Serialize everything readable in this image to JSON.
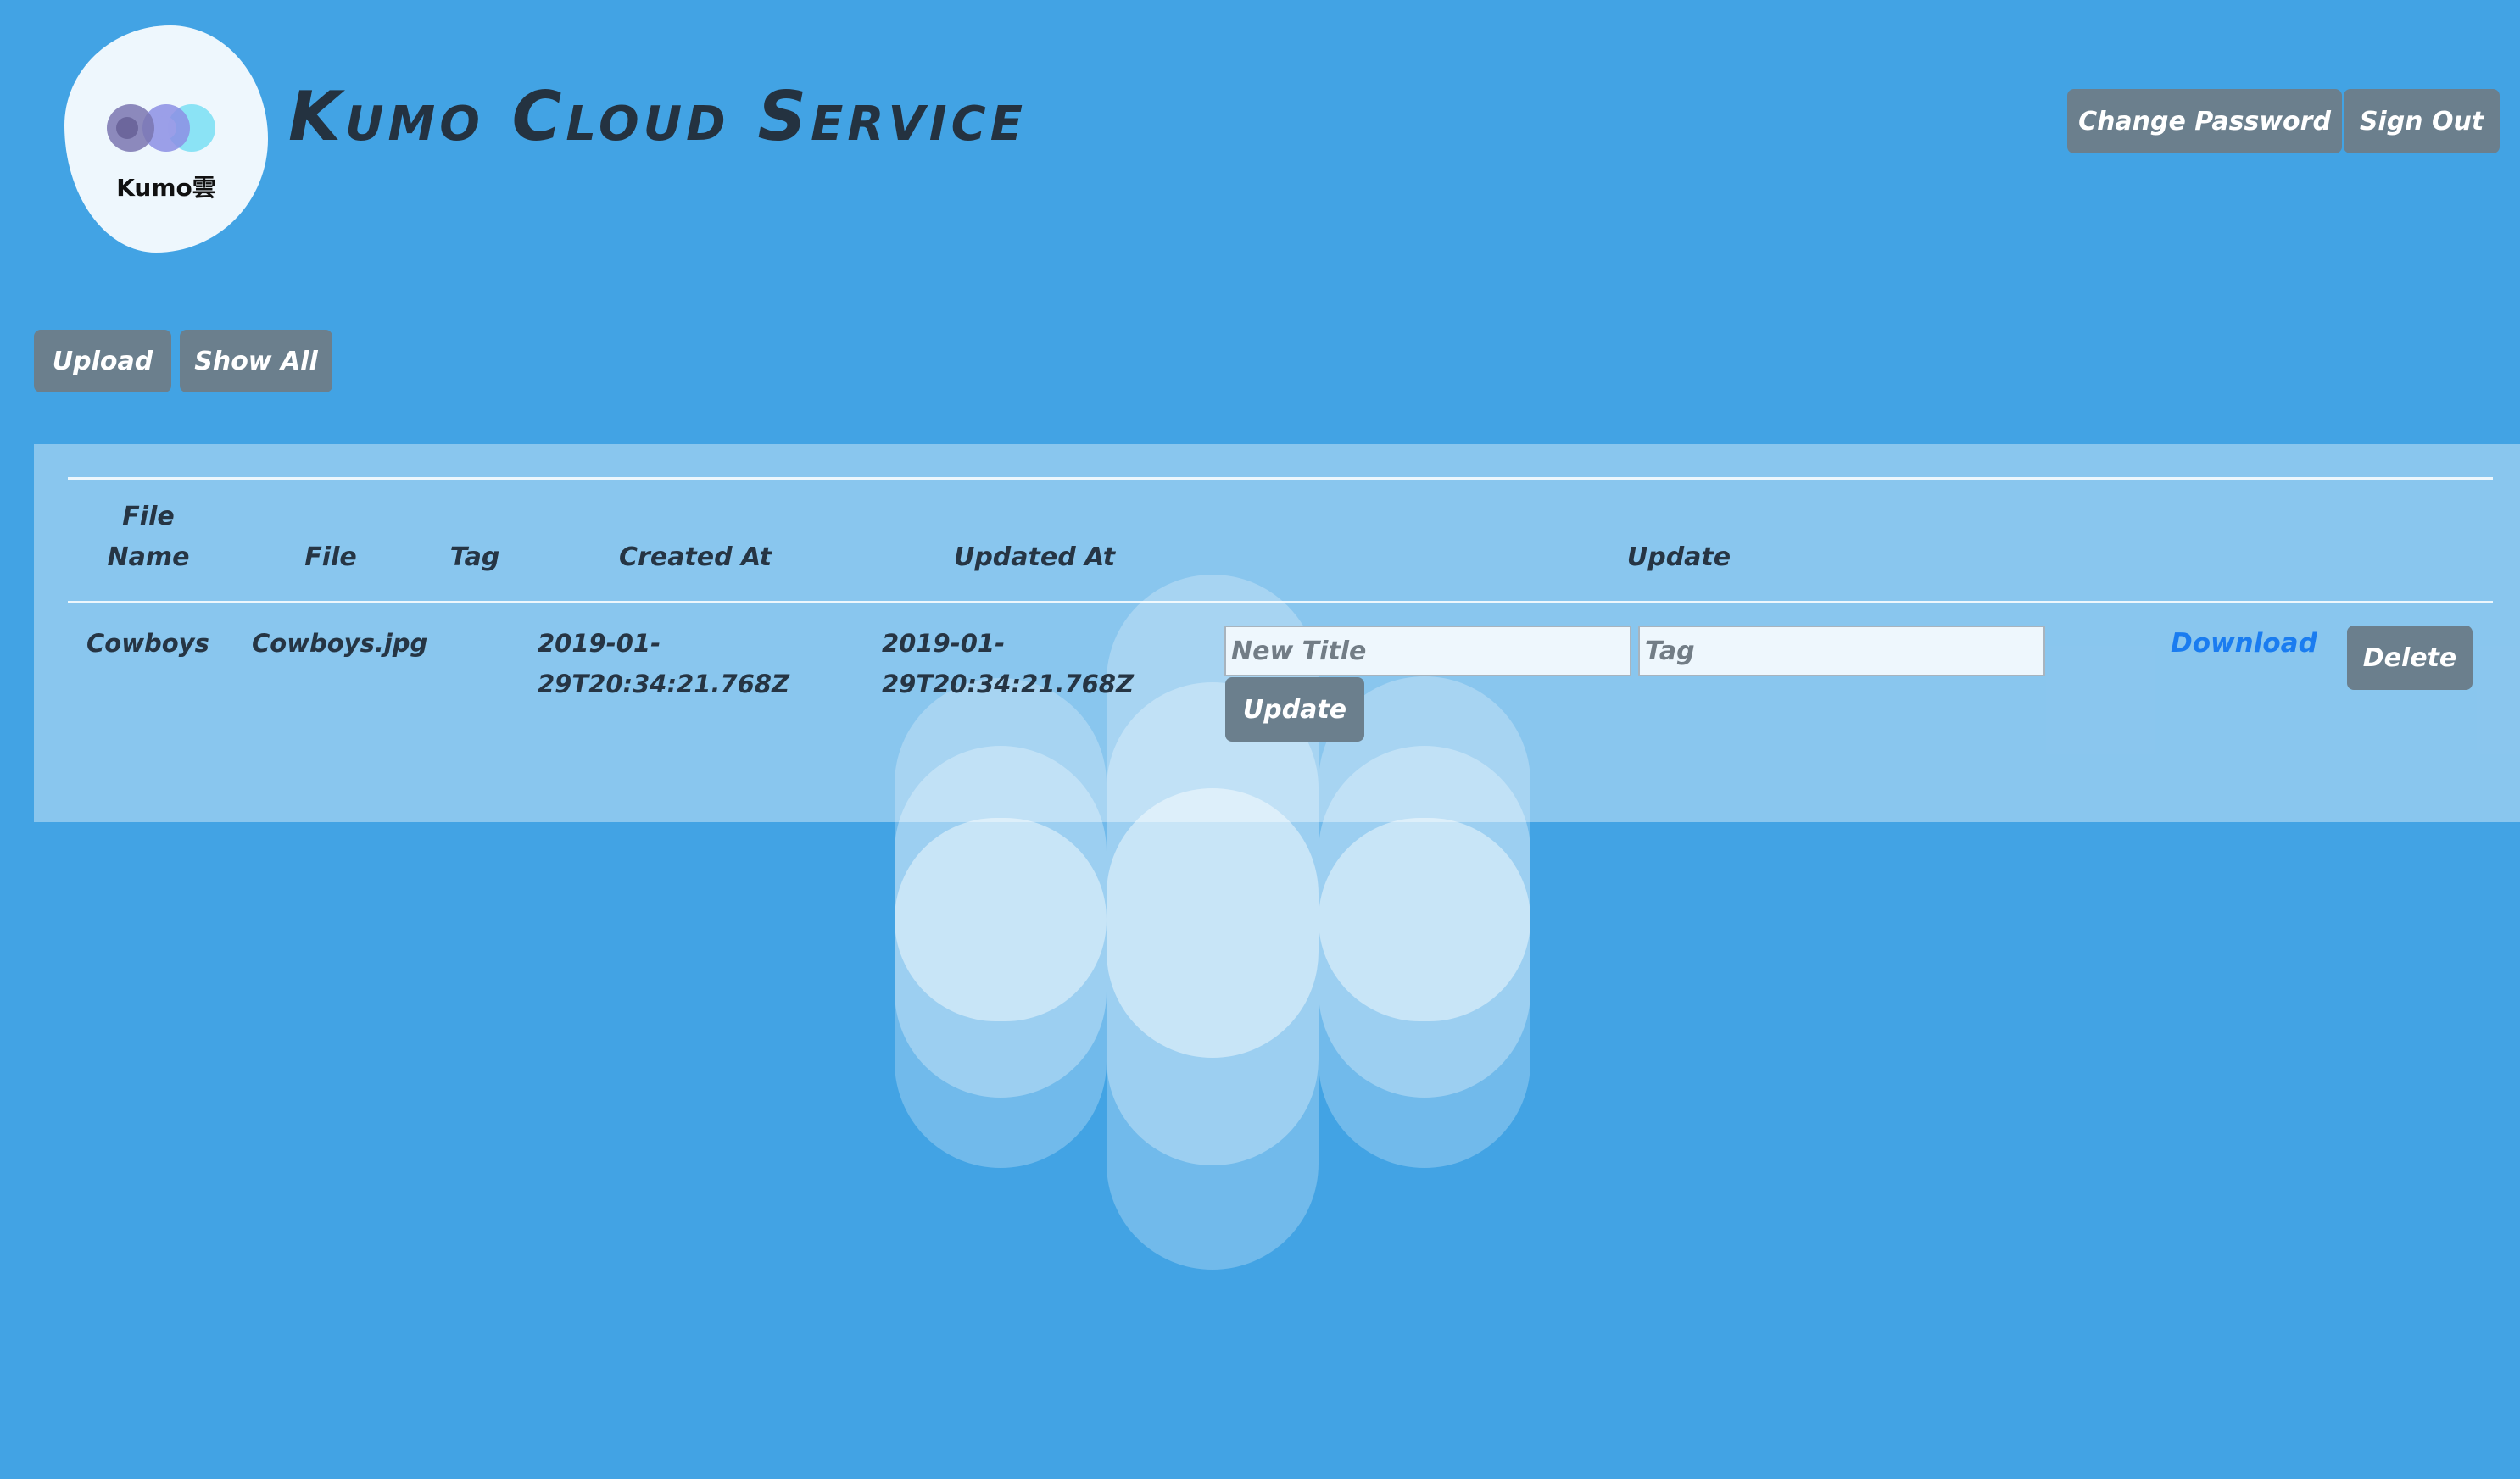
{
  "header": {
    "logo_text": "Kumo雲",
    "title": "Kumo Cloud Service",
    "change_password_label": "Change Password",
    "sign_out_label": "Sign Out"
  },
  "toolbar": {
    "upload_label": "Upload",
    "show_all_label": "Show All"
  },
  "table": {
    "headers": {
      "file_name_line1": "File",
      "file_name_line2": "Name",
      "file": "File",
      "tag": "Tag",
      "created_at": "Created At",
      "updated_at": "Updated At",
      "update": "Update"
    },
    "rows": [
      {
        "file_name": "Cowboys",
        "file": "Cowboys.jpg",
        "tag": "",
        "created_at": "2019-01-29T20:34:21.768Z",
        "updated_at": "2019-01-29T20:34:21.768Z",
        "new_title_placeholder": "New Title",
        "tag_placeholder": "Tag",
        "update_label": "Update",
        "download_label": "Download",
        "delete_label": "Delete"
      }
    ]
  },
  "colors": {
    "background": "#42a3e4",
    "button": "#6b7f8d",
    "link": "#1a7cf0",
    "text": "#263544"
  },
  "icons": [
    "kumo-logo-icon",
    "cloud-art"
  ]
}
